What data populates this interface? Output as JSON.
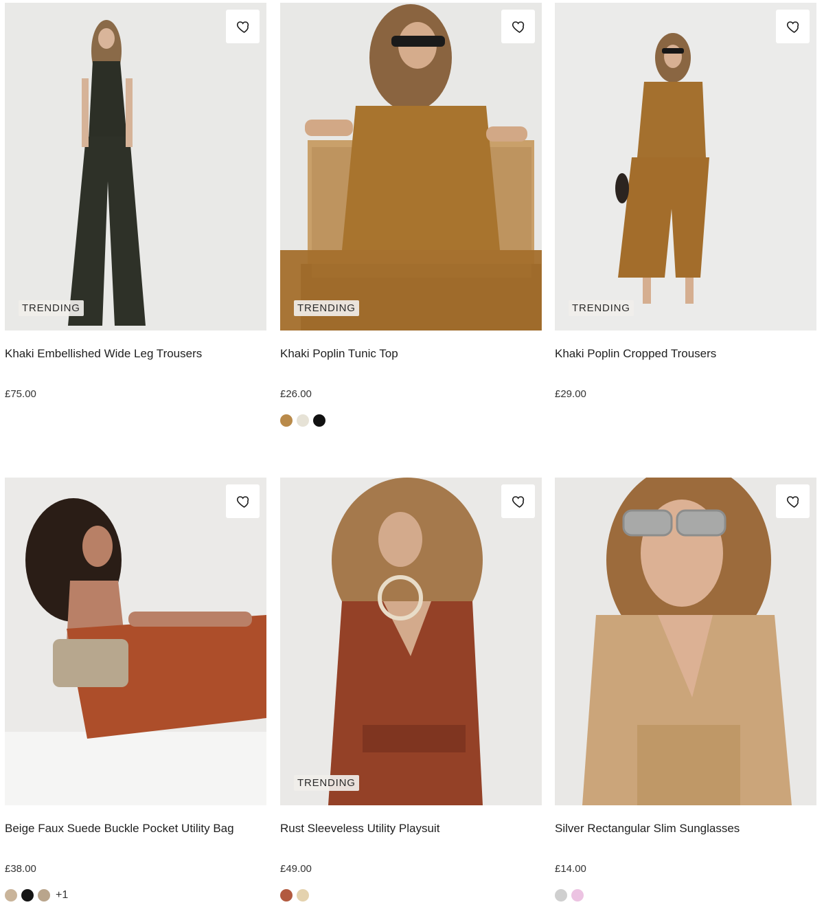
{
  "products": [
    {
      "name": "Khaki Embellished Wide Leg Trousers",
      "price": "£75.00",
      "badge": "TRENDING",
      "wishlist_icon": "heart-outline-icon",
      "swatches": [],
      "more": ""
    },
    {
      "name": "Khaki Poplin Tunic Top",
      "price": "£26.00",
      "badge": "TRENDING",
      "wishlist_icon": "heart-outline-icon",
      "swatches": [
        "#b98a4a",
        "#e6e2d6",
        "#111111"
      ],
      "more": ""
    },
    {
      "name": "Khaki Poplin Cropped Trousers",
      "price": "£29.00",
      "badge": "TRENDING",
      "wishlist_icon": "heart-outline-icon",
      "swatches": [],
      "more": ""
    },
    {
      "name": "Beige Faux Suede Buckle Pocket Utility Bag",
      "price": "£38.00",
      "badge": "",
      "wishlist_icon": "heart-outline-icon",
      "swatches": [
        "#c9b49a",
        "#151515",
        "#b9a58c"
      ],
      "more": "+1"
    },
    {
      "name": "Rust Sleeveless Utility Playsuit",
      "price": "£49.00",
      "badge": "TRENDING",
      "wishlist_icon": "heart-outline-icon",
      "swatches": [
        "#b25a3f",
        "#e4d2ae"
      ],
      "more": ""
    },
    {
      "name": "Silver Rectangular Slim Sunglasses",
      "price": "£14.00",
      "badge": "",
      "wishlist_icon": "heart-outline-icon",
      "swatches": [
        "#cfcfcf",
        "#ecc3e2"
      ],
      "more": ""
    }
  ]
}
